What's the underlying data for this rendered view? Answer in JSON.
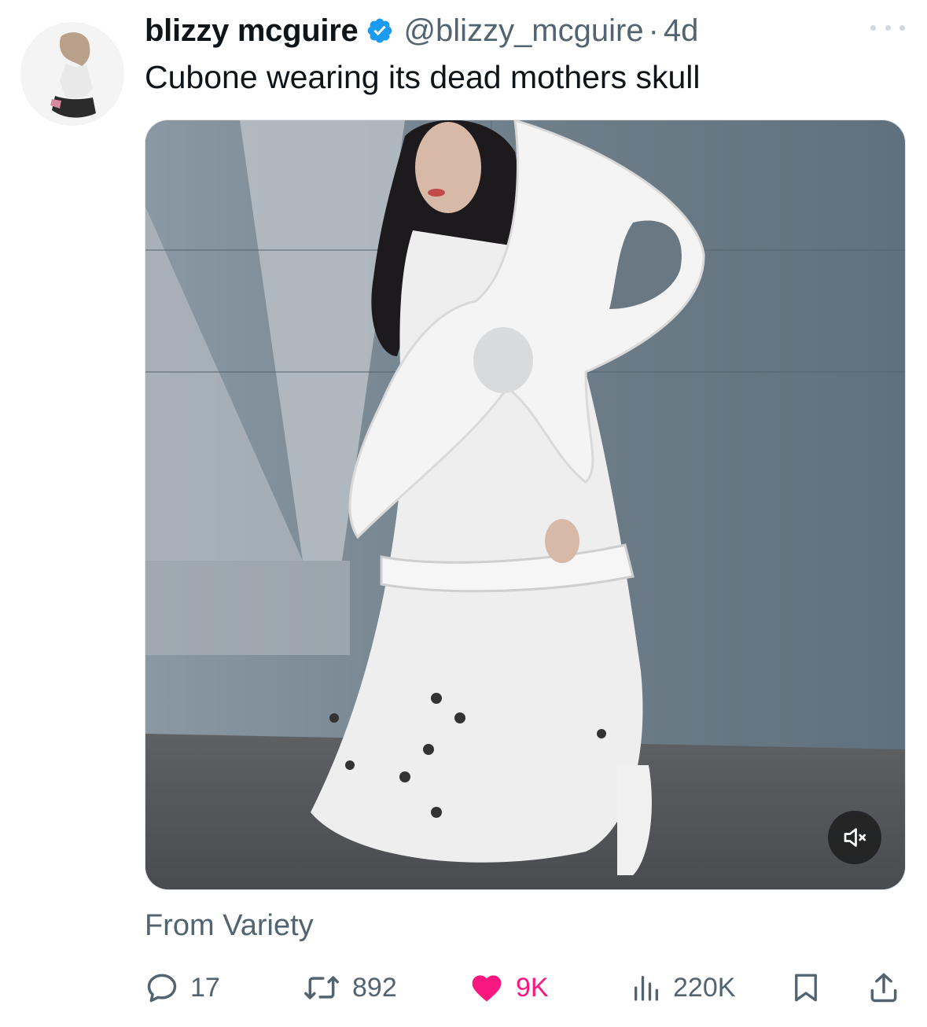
{
  "author": {
    "display_name": "blizzy mcguire",
    "handle": "@blizzy_mcguire",
    "separator": "·",
    "time_ago": "4d",
    "verified_icon": "verified-badge-icon",
    "avatar_icon": "avatar"
  },
  "tweet": {
    "text": "Cubone wearing its dead mothers skull"
  },
  "media": {
    "type": "video",
    "mute_icon": "volume-muted-icon"
  },
  "source": "From Variety",
  "actions": {
    "reply_count": "17",
    "retweet_count": "892",
    "like_count": "9K",
    "view_count": "220K"
  },
  "colors": {
    "text_primary": "#0f1419",
    "text_secondary": "#536471",
    "verified": "#1d9bf0",
    "like": "#f91880"
  }
}
